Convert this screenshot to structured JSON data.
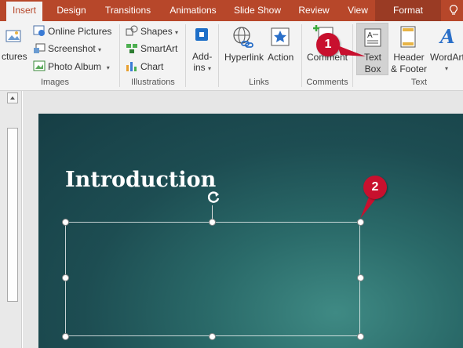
{
  "tabs": [
    "Insert",
    "Design",
    "Transitions",
    "Animations",
    "Slide Show",
    "Review",
    "View",
    "Format"
  ],
  "tab_bulb_icon": "lightbulb-icon",
  "ribbon": {
    "images": {
      "pictures_label": "ctures",
      "online_pictures": "Online Pictures",
      "screenshot": "Screenshot",
      "photo_album": "Photo Album",
      "group": "Images"
    },
    "illustrations": {
      "shapes": "Shapes",
      "smartart": "SmartArt",
      "chart": "Chart",
      "group": "Illustrations"
    },
    "addins": {
      "label1": "Add-",
      "label2": "ins"
    },
    "links": {
      "hyperlink": "Hyperlink",
      "action": "Action",
      "group": "Links"
    },
    "comments": {
      "comment": "Comment",
      "group": "Comments"
    },
    "text": {
      "textbox1": "Text",
      "textbox2": "Box",
      "header1": "Header",
      "header2": "& Footer",
      "wordart": "WordArt",
      "group": "Text"
    }
  },
  "callouts": {
    "one": "1",
    "two": "2"
  },
  "slide": {
    "title": "Introduction"
  },
  "colors": {
    "accent": "#b7472a",
    "callout": "#c8102e"
  }
}
